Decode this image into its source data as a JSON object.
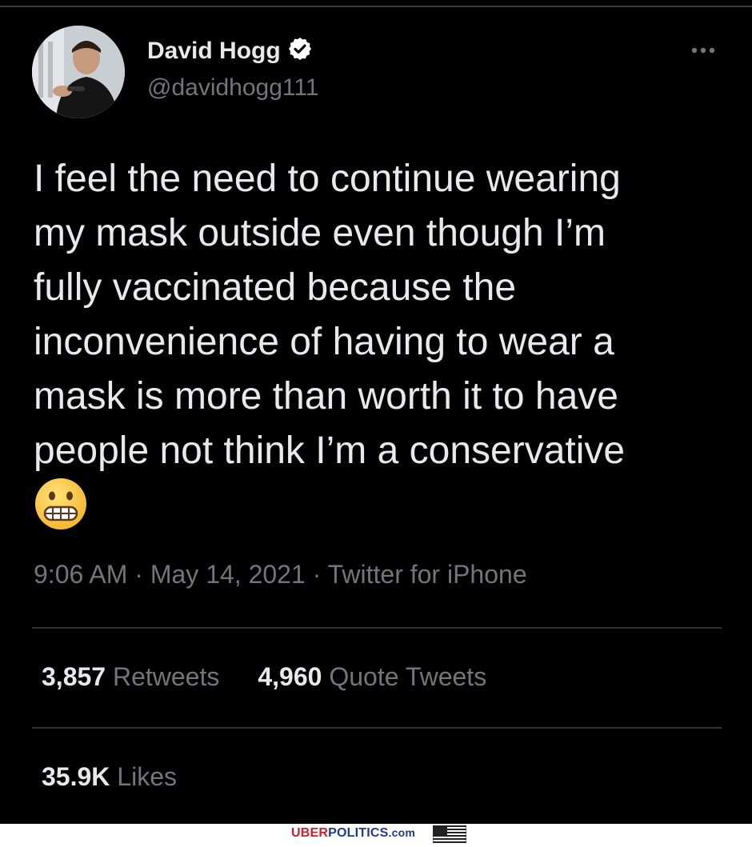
{
  "tweet": {
    "author": {
      "display_name": "David Hogg",
      "handle": "@davidhogg111",
      "verified": true
    },
    "text": "I feel the need to continue wearing\nmy mask outside even though I’m\nfully vaccinated because the\ninconvenience of having to wear a\nmask is more than worth it to have\npeople not think I’m a conservative",
    "emoji": "grimacing-face",
    "meta": "9:06 AM · May 14, 2021 · Twitter for iPhone",
    "stats": {
      "retweets_count": "3,857",
      "retweets_label": "Retweets",
      "quote_tweets_count": "4,960",
      "quote_tweets_label": "Quote Tweets",
      "likes_count": "35.9K",
      "likes_label": "Likes"
    }
  },
  "watermark": {
    "uber": "UBER",
    "politics": "POLITICS",
    "com": ".com"
  },
  "colors": {
    "background": "#000000",
    "primary_text": "#e7e9ea",
    "secondary_text": "#71767b",
    "divider": "#2f3336",
    "verified_badge": "#ffffff"
  },
  "icons": {
    "verified": "verified-badge-icon",
    "more": "more-options-icon"
  }
}
